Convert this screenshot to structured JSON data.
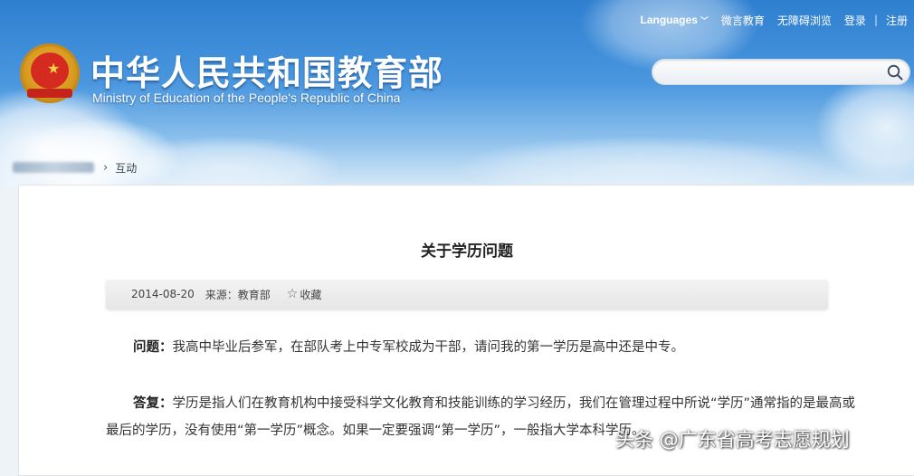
{
  "header": {
    "title_cn": "中华人民共和国教育部",
    "title_en": "Ministry of Education of the People's Republic of China",
    "topnav": {
      "languages": "Languages",
      "weibo": "微言教育",
      "accessible": "无障碍浏览",
      "login": "登录",
      "separator": "|",
      "register": "注册"
    },
    "search": {
      "placeholder": "",
      "icon": "search-icon"
    }
  },
  "breadcrumb": {
    "current": "互动",
    "arrow": "›"
  },
  "article": {
    "title": "关于学历问题",
    "meta": {
      "date": "2014-08-20",
      "source": "来源：教育部",
      "favorite": "收藏",
      "favorite_icon": "☆"
    },
    "question_label": "问题：",
    "question_text": "我高中毕业后参军，在部队考上中专军校成为干部，请问我的第一学历是高中还是中专。",
    "answer_label": "答复：",
    "answer_text": "学历是指人们在教育机构中接受科学文化教育和技能训练的学习经历，我们在管理过程中所说“学历”通常指的是最高或最后的学历，没有使用“第一学历”概念。如果一定要强调“第一学历”，一般指大学本科学历。"
  },
  "watermark": {
    "text": "头条 @广东省高考志愿规划"
  },
  "colors": {
    "header_top": "#2e7fd0",
    "header_bottom": "#d5e8f7",
    "emblem_red": "#d42a1f",
    "emblem_gold": "#e8b93a"
  }
}
